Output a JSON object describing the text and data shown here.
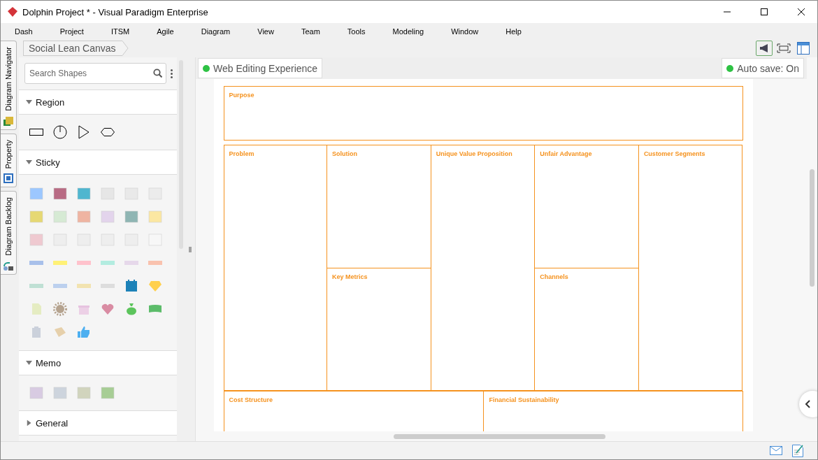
{
  "window": {
    "title": "Dolphin Project * - Visual Paradigm Enterprise"
  },
  "menu": [
    "Dash",
    "Project",
    "ITSM",
    "Agile",
    "Diagram",
    "View",
    "Team",
    "Tools",
    "Modeling",
    "Window",
    "Help"
  ],
  "side_tabs": [
    {
      "label": "Diagram Navigator"
    },
    {
      "label": "Property"
    },
    {
      "label": "Diagram Backlog"
    }
  ],
  "breadcrumb": "Social Lean Canvas",
  "palette": {
    "search": {
      "placeholder": "Search Shapes"
    },
    "sections": [
      {
        "title": "Region",
        "expanded": true,
        "kind": "region"
      },
      {
        "title": "Sticky",
        "expanded": true,
        "kind": "sticky"
      },
      {
        "title": "Memo",
        "expanded": true,
        "kind": "memo"
      },
      {
        "title": "General",
        "expanded": false
      }
    ]
  },
  "chips": [
    {
      "label": "Web Editing Experience",
      "on": true
    },
    {
      "label": "Auto save: On",
      "on": true
    }
  ],
  "canvas": {
    "purpose": "Purpose",
    "columns": [
      {
        "cells": [
          "Problem"
        ]
      },
      {
        "cells": [
          "Solution",
          "Key Metrics"
        ]
      },
      {
        "cells": [
          "Unique Value Proposition"
        ]
      },
      {
        "cells": [
          "Unfair Advantage",
          "Channels"
        ]
      },
      {
        "cells": [
          "Customer Segments"
        ]
      }
    ],
    "bottom": [
      "Cost Structure",
      "Financial Sustainability"
    ]
  }
}
